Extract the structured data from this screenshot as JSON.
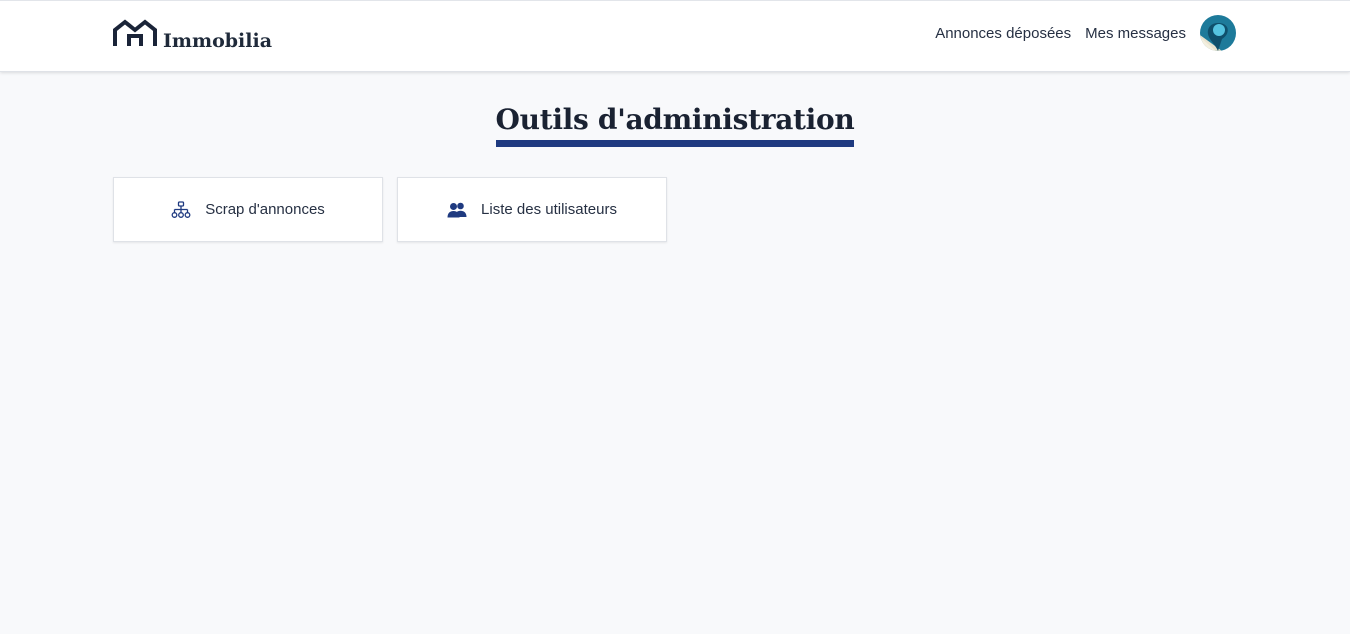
{
  "brand": {
    "name": "Immobilia",
    "icon": "house-icon"
  },
  "nav": {
    "items": [
      {
        "label": "Annonces déposées"
      },
      {
        "label": "Mes messages"
      }
    ],
    "avatar_icon": "avatar"
  },
  "page": {
    "title": "Outils d'administration"
  },
  "tools": [
    {
      "label": "Scrap d'annonces",
      "icon": "sitemap-icon"
    },
    {
      "label": "Liste des utilisateurs",
      "icon": "users-icon"
    }
  ],
  "colors": {
    "accent": "#1f3a80",
    "background": "#f8f9fb",
    "text": "#263043"
  }
}
